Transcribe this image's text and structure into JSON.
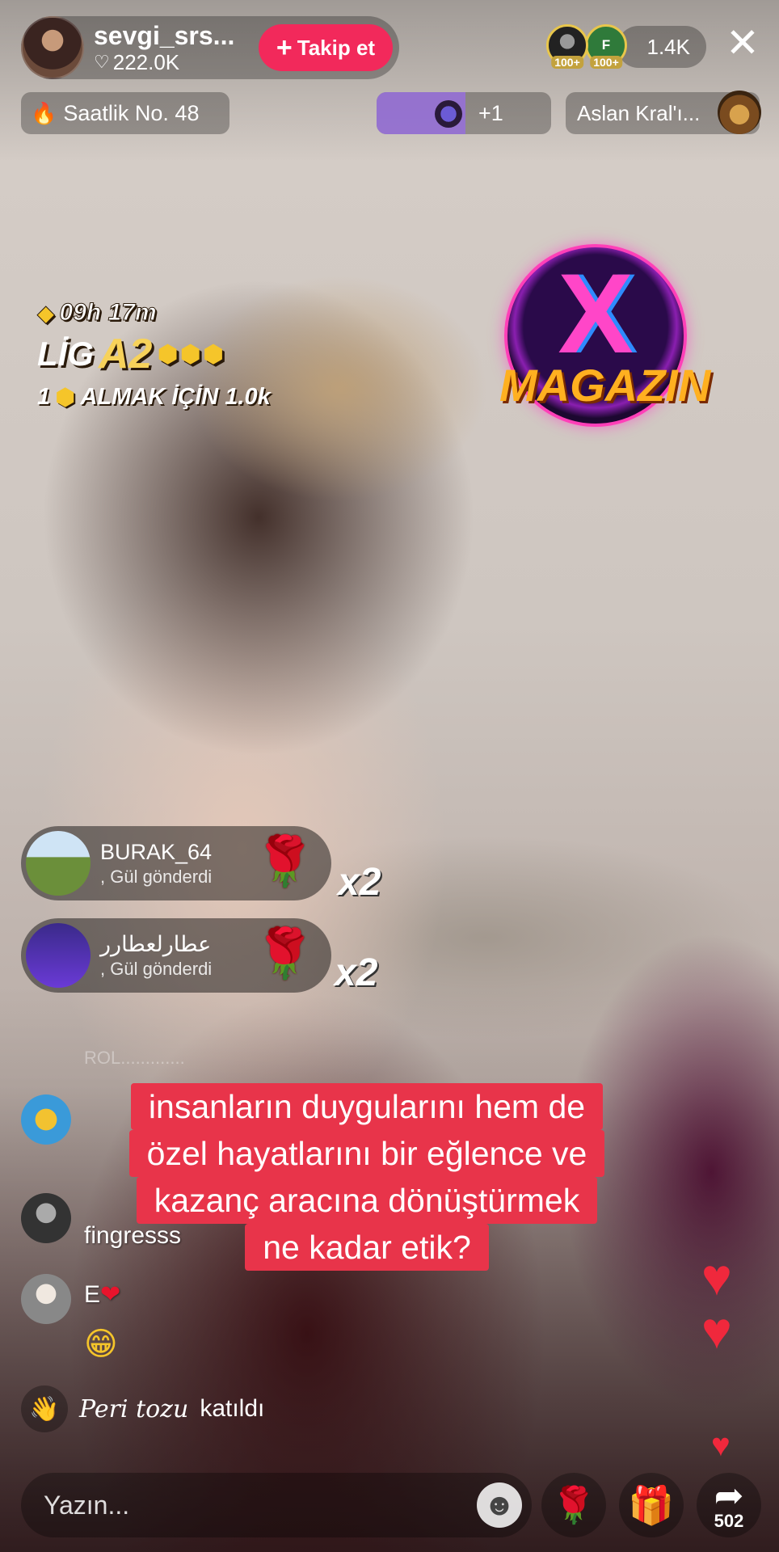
{
  "host": {
    "name": "sevgi_srs...",
    "likes": "222.0K",
    "follow_label": "Takip et"
  },
  "viewers": {
    "avatar_badges": [
      "100+",
      "100+"
    ],
    "avatar2_initial": "F",
    "count": "1.4K"
  },
  "badges": {
    "hourly_rank": "Saatlik No. 48",
    "gifters_extra": "+1",
    "king_label": "Aslan Kral'ı..."
  },
  "league": {
    "timer": "09h 17m",
    "rank_prefix": "LİG",
    "rank_tier": "A2",
    "goal_count": "1",
    "goal_text": "ALMAK İÇİN 1.0k"
  },
  "logo": {
    "mark": "X",
    "text": "MAGAZIN"
  },
  "gifts": [
    {
      "user": "BURAK_64",
      "action": ", Gül  gönderdi",
      "multiplier": "x2"
    },
    {
      "user": "عطارلعطارر",
      "action": ", Gül  gönderdi",
      "multiplier": "x2"
    }
  ],
  "chat": {
    "faded": "ROL.............",
    "line_a2": "fingresss",
    "line_a3": "E",
    "join_user": "Peri tozu",
    "join_action": "katıldı"
  },
  "caption": {
    "lines": [
      "insanların duygularını hem de",
      "özel hayatlarını bir eğlence ve",
      "kazanç aracına dönüştürmek",
      "ne kadar etik?"
    ]
  },
  "bottom": {
    "comment_placeholder": "Yazın...",
    "share_count": "502"
  },
  "colors": {
    "follow_button": "#f2295b",
    "caption_background": "#e8344a",
    "heart": "#f0283c"
  }
}
